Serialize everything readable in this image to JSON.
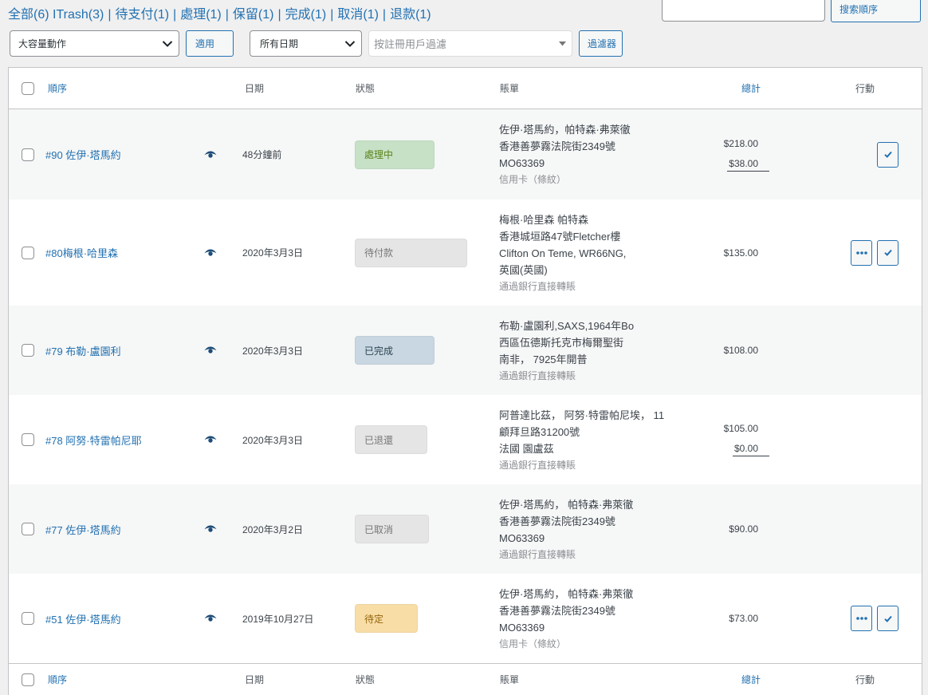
{
  "status_filters": [
    {
      "label": "全部(6)"
    },
    {
      "label": "ITrash(3)"
    },
    {
      "sep": "|",
      "label": "待支付(1)"
    },
    {
      "sep": "|",
      "label": "處理(1)"
    },
    {
      "sep": "|",
      "label": "保留(1)"
    },
    {
      "sep": "|",
      "label": "完成(1)"
    },
    {
      "sep": "|",
      "label": "取消(1)"
    },
    {
      "sep": "|",
      "label": "退款(1)"
    }
  ],
  "search": {
    "button_label": "搜索順序"
  },
  "bulk_actions": {
    "selected": "大容量動作",
    "apply_label": "適用"
  },
  "date_filter": {
    "selected": "所有日期"
  },
  "customer_filter": {
    "placeholder": "按註冊用戶過濾"
  },
  "filter_button_label": "過濾器",
  "columns": {
    "order": "順序",
    "date": "日期",
    "status": "狀態",
    "billing": "賬單",
    "total": "總計",
    "actions": "行動"
  },
  "icons": {
    "preview": "eye-icon",
    "select_dropdown": "chevron-down-icon",
    "customer_dropdown": "triangle-down-icon"
  },
  "colors": {
    "accent": "#2271b1"
  },
  "orders": [
    {
      "name": "#90 佐伊·塔馬約",
      "date": "48分鐘前",
      "status": {
        "label": "處理中",
        "bg": "#c6e1c6",
        "fg": "#5b841b"
      },
      "billing": [
        "佐伊·塔馬約，帕特森·弗萊徹",
        "香港善夢霧法院街2349號",
        "MO63369"
      ],
      "payment": "信用卡（條紋）",
      "totals": [
        "$218.00",
        "$38.00"
      ],
      "actions": [
        "checkmark-icon"
      ]
    },
    {
      "name": "#80梅根·哈里森",
      "date": "2020年3月3日",
      "status": {
        "label": "待付款",
        "bg": "#e5e5e5",
        "fg": "#777777"
      },
      "billing": [
        "梅根·哈里森 帕特森",
        "香港城垣路47號Fletcher樓",
        "Clifton On Teme, WR66NG,",
        "英國(英國)"
      ],
      "payment": "通過銀行直接轉賬",
      "totals": [
        "$135.00"
      ],
      "actions": [
        "more-icon",
        "checkmark-icon"
      ]
    },
    {
      "name": "#79 布勒·盧園利",
      "date": "2020年3月3日",
      "status": {
        "label": "已完成",
        "bg": "#c8d7e1",
        "fg": "#2e4453"
      },
      "billing": [
        "布勒·盧園利,SAXS,1964年Bo",
        "西區伍德斯托克市梅爾聖街",
        "南非， 7925年開普"
      ],
      "payment": "通過銀行直接轉賬",
      "totals": [
        "$108.00"
      ],
      "actions": []
    },
    {
      "name": "#78 阿努·特雷帕尼耶",
      "date": "2020年3月3日",
      "status": {
        "label": "已退還",
        "bg": "#e5e5e5",
        "fg": "#777777"
      },
      "billing": [
        "阿普達比茲， 阿努·特雷帕尼埃， 11",
        "顧拜旦路31200號",
        "法國 園盧茲"
      ],
      "payment": "通過銀行直接轉賬",
      "totals": [
        "$105.00",
        "$0.00"
      ],
      "actions": []
    },
    {
      "name": "#77 佐伊·塔馬約",
      "date": "2020年3月2日",
      "status": {
        "label": "已取消",
        "bg": "#e5e5e5",
        "fg": "#777777"
      },
      "billing": [
        "佐伊·塔馬約， 帕特森·弗萊徹",
        "香港善夢霧法院街2349號",
        "MO63369"
      ],
      "payment": "通過銀行直接轉賬",
      "totals": [
        "$90.00"
      ],
      "actions": []
    },
    {
      "name": "#51 佐伊·塔馬約",
      "date": "2019年10月27日",
      "status": {
        "label": "待定",
        "bg": "#f8dda7",
        "fg": "#94660c"
      },
      "billing": [
        "佐伊·塔馬約， 帕特森·弗萊徹",
        "香港善夢霧法院街2349號",
        "MO63369"
      ],
      "payment": "信用卡（條紋）",
      "totals": [
        "$73.00"
      ],
      "actions": [
        "more-icon",
        "checkmark-icon"
      ]
    }
  ]
}
